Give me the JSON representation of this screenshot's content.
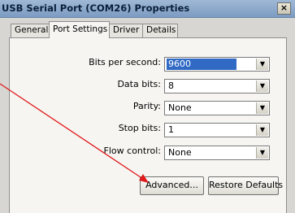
{
  "window": {
    "title": "USB Serial Port (COM26) Properties",
    "close_label": "×"
  },
  "tabs": [
    {
      "label": "General"
    },
    {
      "label": "Port Settings",
      "active": true
    },
    {
      "label": "Driver"
    },
    {
      "label": "Details"
    }
  ],
  "settings": {
    "bits_per_second": {
      "label": "Bits per second:",
      "value": "9600"
    },
    "data_bits": {
      "label": "Data bits:",
      "value": "8"
    },
    "parity": {
      "label": "Parity:",
      "value": "None"
    },
    "stop_bits": {
      "label": "Stop bits:",
      "value": "1"
    },
    "flow_control": {
      "label": "Flow control:",
      "value": "None"
    }
  },
  "buttons": {
    "advanced": "Advanced...",
    "restore_defaults": "Restore Defaults"
  },
  "annotation": {
    "arrow_color": "#e01b1b"
  },
  "icons": {
    "dropdown": "chevron-down-icon"
  }
}
